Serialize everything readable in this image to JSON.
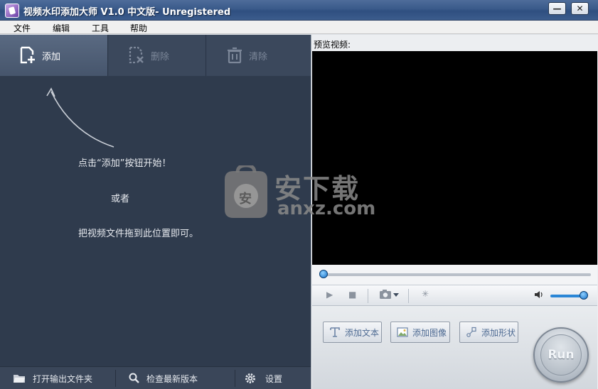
{
  "window": {
    "title": "视频水印添加大师 V1.0 中文版- Unregistered",
    "minimize_label": "—",
    "close_label": "✕"
  },
  "menu": [
    "文件",
    "编辑",
    "工具",
    "帮助"
  ],
  "toolbar": {
    "add_label": "添加",
    "delete_label": "删除",
    "clear_label": "清除"
  },
  "hints": {
    "line1": "点击“添加”按钮开始！",
    "line2": "或者",
    "line3": "把视频文件拖到此位置即可。"
  },
  "bottombar": {
    "open_output_label": "打开输出文件夹",
    "check_update_label": "检查最新版本",
    "settings_label": "设置"
  },
  "preview": {
    "label": "预览视频:",
    "seek_position": 0,
    "volume_level": 0.9
  },
  "watermark": {
    "cn": "安下载",
    "en": "anxz.com",
    "badge": "安"
  },
  "actions": {
    "add_text_label": "添加文本",
    "add_image_label": "添加图像",
    "add_shape_label": "添加形状",
    "run_label": "Run"
  },
  "colors": {
    "left_panel_bg": "#2f3b4d",
    "toolbar_active": "#5a6a82",
    "action_text": "#4d6a92",
    "slider_blue": "#1670c7"
  }
}
